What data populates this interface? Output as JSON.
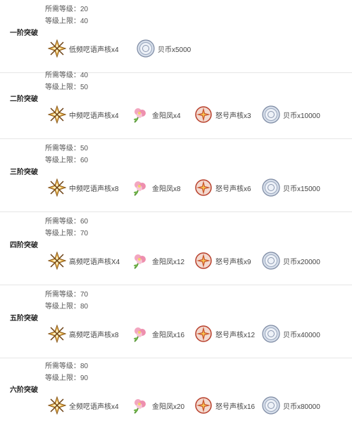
{
  "rows": [
    {
      "stage": "一阶突破",
      "req_level": "所需等级：20",
      "level_cap": "等级上限：40",
      "materials": [
        {
          "icon": "star-core-icon",
          "label": "低频呓语声核x4"
        },
        {
          "icon": "shell-coin-icon",
          "label": "贝币x5000"
        }
      ]
    },
    {
      "stage": "二阶突破",
      "req_level": "所需等级：40",
      "level_cap": "等级上限：50",
      "materials": [
        {
          "icon": "star-core-icon",
          "label": "中频呓语声核x4"
        },
        {
          "icon": "flower-icon",
          "label": "金阳凤x4"
        },
        {
          "icon": "roar-core-icon",
          "label": "怒号声核x3"
        },
        {
          "icon": "shell-coin-icon",
          "label": "贝币x10000"
        }
      ]
    },
    {
      "stage": "三阶突破",
      "req_level": "所需等级：50",
      "level_cap": "等级上限：60",
      "materials": [
        {
          "icon": "star-core-icon",
          "label": "中频呓语声核x8"
        },
        {
          "icon": "flower-icon",
          "label": "金阳凤x8"
        },
        {
          "icon": "roar-core-icon",
          "label": "怒号声核x6"
        },
        {
          "icon": "shell-coin-icon",
          "label": "贝币x15000"
        }
      ]
    },
    {
      "stage": "四阶突破",
      "req_level": "所需等级：60",
      "level_cap": "等级上限：70",
      "materials": [
        {
          "icon": "star-core-icon",
          "label": "高频呓语声核X4"
        },
        {
          "icon": "flower-icon",
          "label": "金阳凤x12"
        },
        {
          "icon": "roar-core-icon",
          "label": "怒号声核x9"
        },
        {
          "icon": "shell-coin-icon",
          "label": "贝币x20000"
        }
      ]
    },
    {
      "stage": "五阶突破",
      "req_level": "所需等级：70",
      "level_cap": "等级上限：80",
      "materials": [
        {
          "icon": "star-core-icon",
          "label": "高频呓语声核x8"
        },
        {
          "icon": "flower-icon",
          "label": "金阳凤x16"
        },
        {
          "icon": "roar-core-icon",
          "label": "怒号声核x12"
        },
        {
          "icon": "shell-coin-icon",
          "label": "贝币x40000"
        }
      ]
    },
    {
      "stage": "六阶突破",
      "req_level": "所需等级：80",
      "level_cap": "等级上限：90",
      "materials": [
        {
          "icon": "star-core-icon",
          "label": "全频呓语声核x4"
        },
        {
          "icon": "flower-icon",
          "label": "金阳凤x20"
        },
        {
          "icon": "roar-core-icon",
          "label": "怒号声核x16"
        },
        {
          "icon": "shell-coin-icon",
          "label": "贝币x80000"
        }
      ]
    }
  ],
  "colors": {
    "text": "#333333",
    "divider": "#e6e6e6",
    "gold": "#d9a23a",
    "pink": "#e889a6",
    "red": "#b8402c",
    "silver": "#a9b4c8"
  }
}
